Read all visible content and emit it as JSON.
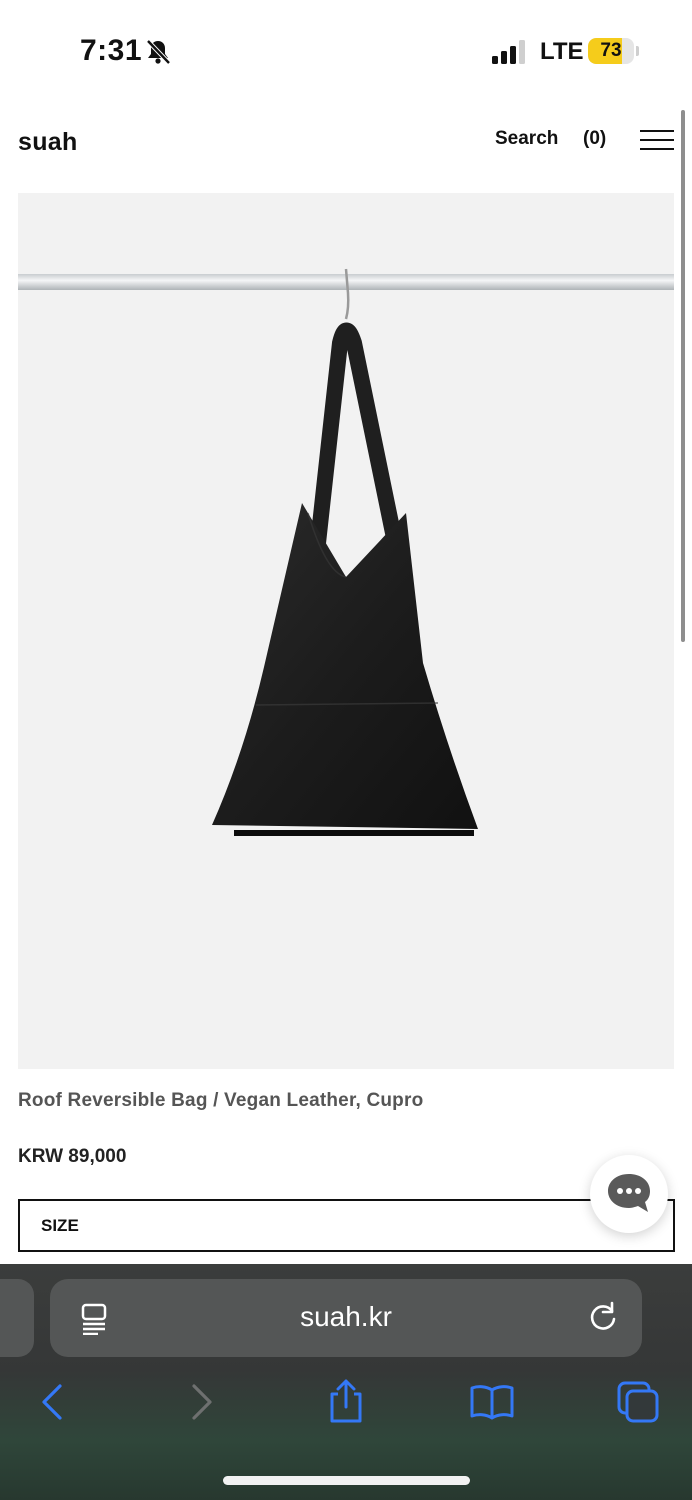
{
  "status_bar": {
    "time": "7:31",
    "network": "LTE",
    "battery": "73",
    "battery_level": 0.73
  },
  "header": {
    "logo": "suah",
    "search_label": "Search",
    "cart_label": "(0)"
  },
  "product": {
    "title": "Roof Reversible Bag / Vegan Leather, Cupro",
    "price": "KRW 89,000",
    "size_label": "SIZE"
  },
  "browser": {
    "url": "suah.kr"
  },
  "colors": {
    "accent": "#3478f6",
    "battery": "#f5cc1b",
    "safari_bar": "#3b3d3c"
  }
}
